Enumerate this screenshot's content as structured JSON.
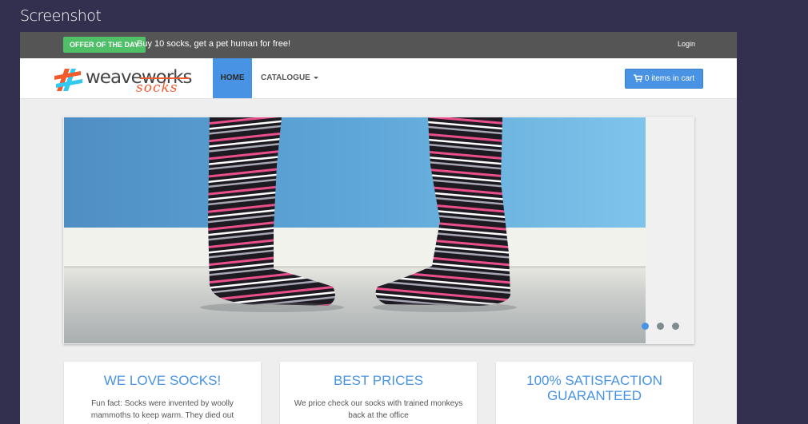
{
  "window": {
    "title": "Screenshot"
  },
  "topbar": {
    "offer_badge": "OFFER OF THE DAY",
    "offer_text": "Buy 10 socks, get a pet human for free!",
    "login_label": "Login"
  },
  "navbar": {
    "logo_word": "weaveworks",
    "logo_sub": "socks",
    "home_label": "HOME",
    "catalogue_label": "CATALOGUE",
    "cart_label": "0 items in cart",
    "cart_icon": "shopping-cart-icon"
  },
  "carousel": {
    "slide_count": 3,
    "active_index": 0
  },
  "features": [
    {
      "title": "WE LOVE SOCKS!",
      "text": "Fun fact: Socks were invented by woolly mammoths to keep warm. They died out because"
    },
    {
      "title": "BEST PRICES",
      "text": "We price check our socks with trained monkeys back at the office"
    },
    {
      "title": "100% SATISFACTION GUARANTEED",
      "text": ""
    }
  ],
  "colors": {
    "accent": "#4993e4",
    "offer_green": "#4fbf68",
    "topbar": "#555555",
    "logo_orange": "#ef5b2f",
    "background": "#33304f"
  }
}
